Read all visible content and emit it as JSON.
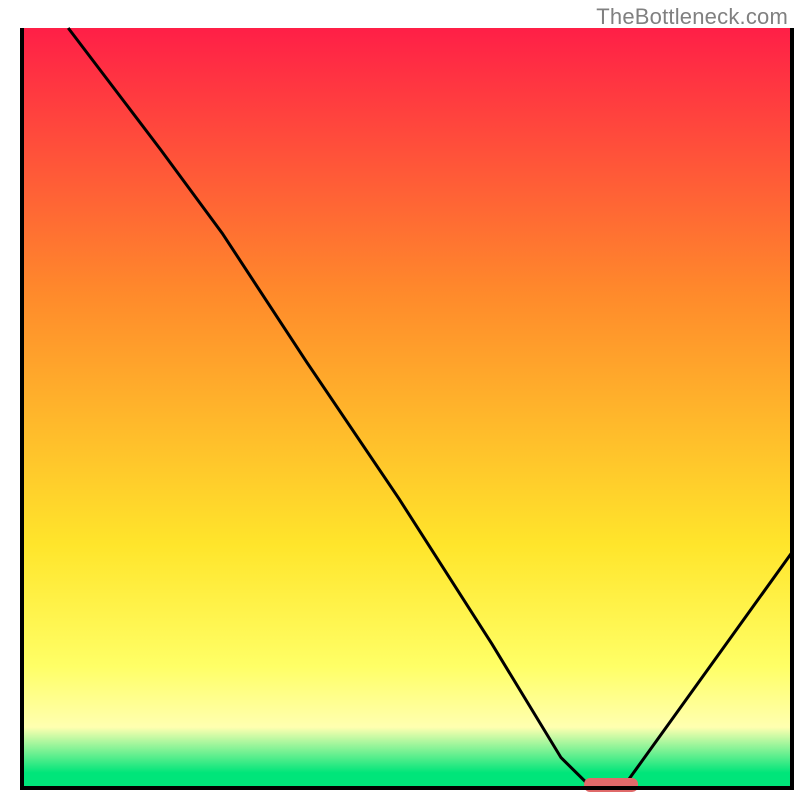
{
  "watermark": "TheBottleneck.com",
  "colors": {
    "gradient_top": "#ff1f47",
    "gradient_mid1": "#ff8a2b",
    "gradient_mid2": "#ffe52b",
    "gradient_yellow": "#ffff66",
    "gradient_pale": "#ffffb0",
    "gradient_green": "#00e57a",
    "line": "#000000",
    "marker": "#e06a6a",
    "frame": "#000000"
  },
  "chart_data": {
    "type": "line",
    "title": "",
    "xlabel": "",
    "ylabel": "",
    "xlim": [
      0,
      100
    ],
    "ylim": [
      0,
      100
    ],
    "grid": false,
    "legend": false,
    "background_gradient": [
      {
        "offset": 0.0,
        "color": "#ff1f47"
      },
      {
        "offset": 0.35,
        "color": "#ff8a2b"
      },
      {
        "offset": 0.68,
        "color": "#ffe52b"
      },
      {
        "offset": 0.84,
        "color": "#ffff66"
      },
      {
        "offset": 0.92,
        "color": "#ffffb0"
      },
      {
        "offset": 0.98,
        "color": "#00e57a"
      },
      {
        "offset": 1.0,
        "color": "#00e57a"
      }
    ],
    "series": [
      {
        "name": "bottleneck-curve",
        "x": [
          6,
          18,
          26,
          37,
          49,
          61,
          70,
          74,
          78,
          100
        ],
        "y": [
          100,
          84,
          73,
          56,
          38,
          19,
          4,
          0,
          0,
          31
        ]
      }
    ],
    "marker": {
      "name": "optimal-range",
      "x_start": 73,
      "x_end": 80,
      "y": 0.4
    }
  }
}
